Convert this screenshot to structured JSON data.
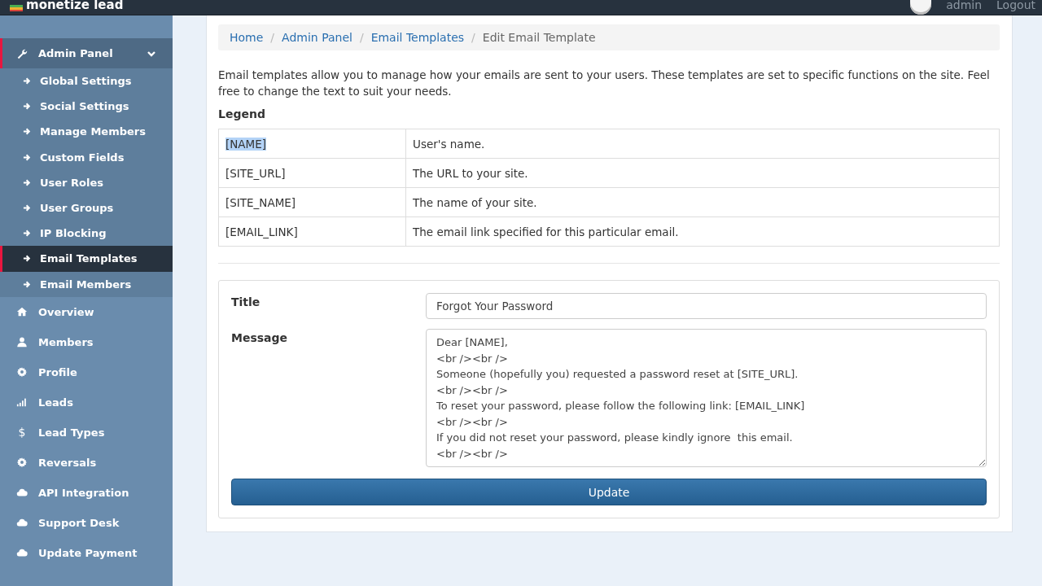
{
  "header": {
    "brand": "monetize lead",
    "user": "admin",
    "logout": "Logout"
  },
  "sidebar": {
    "items": [
      {
        "label": "Admin Panel",
        "kind": "wrench",
        "expanded": true,
        "selected": false,
        "children": [
          {
            "label": "Global Settings",
            "selected": false
          },
          {
            "label": "Social Settings",
            "selected": false
          },
          {
            "label": "Manage Members",
            "selected": false
          },
          {
            "label": "Custom Fields",
            "selected": false
          },
          {
            "label": "User Roles",
            "selected": false
          },
          {
            "label": "User Groups",
            "selected": false
          },
          {
            "label": "IP Blocking",
            "selected": false
          },
          {
            "label": "Email Templates",
            "selected": true
          },
          {
            "label": "Email Members",
            "selected": false
          }
        ]
      },
      {
        "label": "Overview",
        "kind": "home",
        "selected": false
      },
      {
        "label": "Members",
        "kind": "user",
        "selected": false
      },
      {
        "label": "Profile",
        "kind": "gear",
        "selected": false
      },
      {
        "label": "Leads",
        "kind": "bars",
        "selected": false
      },
      {
        "label": "Lead Types",
        "kind": "symbol",
        "symbol": "$",
        "selected": false
      },
      {
        "label": "Reversals",
        "kind": "gear",
        "selected": false
      },
      {
        "label": "API Integration",
        "kind": "cloud",
        "selected": false
      },
      {
        "label": "Support Desk",
        "kind": "cloud",
        "selected": false
      },
      {
        "label": "Update Payment",
        "kind": "cloud",
        "selected": false
      }
    ]
  },
  "breadcrumb": [
    {
      "label": "Home",
      "link": true
    },
    {
      "label": "Admin Panel",
      "link": true,
      "separator": "/"
    },
    {
      "label": "Email Templates",
      "link": true,
      "separator": "/"
    },
    {
      "label": "Edit Email Template",
      "link": false,
      "separator": "/"
    }
  ],
  "intro": "Email templates allow you to manage how your emails are sent to your users. These templates are set to specific functions on the site. Feel free to change the text to suit your needs.",
  "legend": {
    "title": "Legend",
    "rows": [
      {
        "key": "[NAME]",
        "description": "User's name.",
        "highlighted": true
      },
      {
        "key": "[SITE_URL]",
        "description": "The URL to your site.",
        "highlighted": false
      },
      {
        "key": "[SITE_NAME]",
        "description": "The name of your site.",
        "highlighted": false
      },
      {
        "key": "[EMAIL_LINK]",
        "description": "The email link specified for this particular email.",
        "highlighted": false
      }
    ]
  },
  "form": {
    "title_label": "Title",
    "title_value": "Forgot Your Password",
    "message_label": "Message",
    "message_lines": [
      "Dear [NAME],",
      "<br /><br />",
      "Someone (hopefully you) requested a password reset at [SITE_URL].",
      "<br /><br />",
      "To reset your password, please follow the following link: [EMAIL_LINK]",
      "<br /><br />",
      "If you did not reset your password, please kindly ignore  this email.",
      "<br /><br />"
    ],
    "button": "Update"
  }
}
